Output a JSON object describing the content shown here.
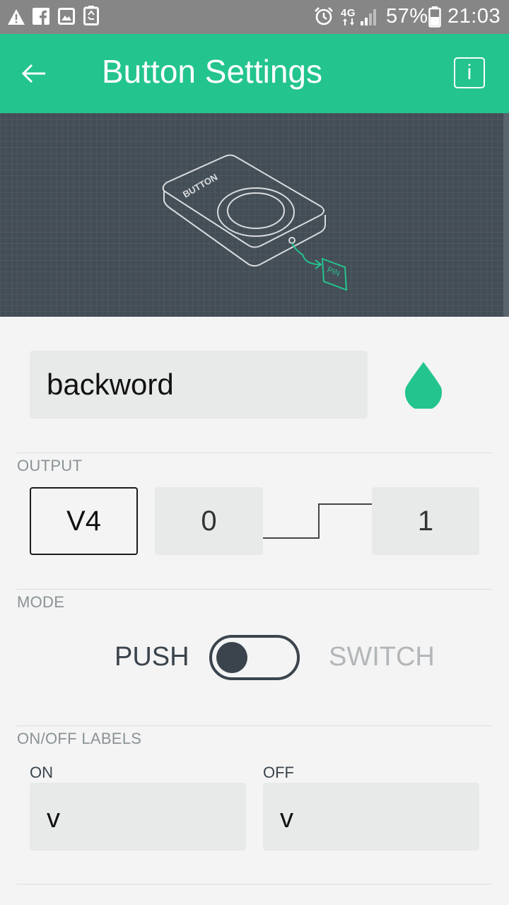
{
  "status_bar": {
    "network": "4G",
    "battery_percent": "57%",
    "time": "21:03"
  },
  "app_bar": {
    "title": "Button Settings",
    "info_label": "i"
  },
  "illustration": {
    "device_label": "BUTTON",
    "pin_label": "PIN"
  },
  "name_field": {
    "value": "backword"
  },
  "colors": {
    "accent": "#23c48e",
    "dark": "#3b444c",
    "status_bar": "#868686"
  },
  "output": {
    "section_label": "OUTPUT",
    "pin": "V4",
    "low_value": "0",
    "high_value": "1"
  },
  "mode": {
    "section_label": "MODE",
    "push_label": "PUSH",
    "switch_label": "SWITCH",
    "selected": "PUSH"
  },
  "labels": {
    "section_label": "ON/OFF LABELS",
    "on_label": "ON",
    "off_label": "OFF",
    "on_value": "v",
    "off_value": "v"
  }
}
